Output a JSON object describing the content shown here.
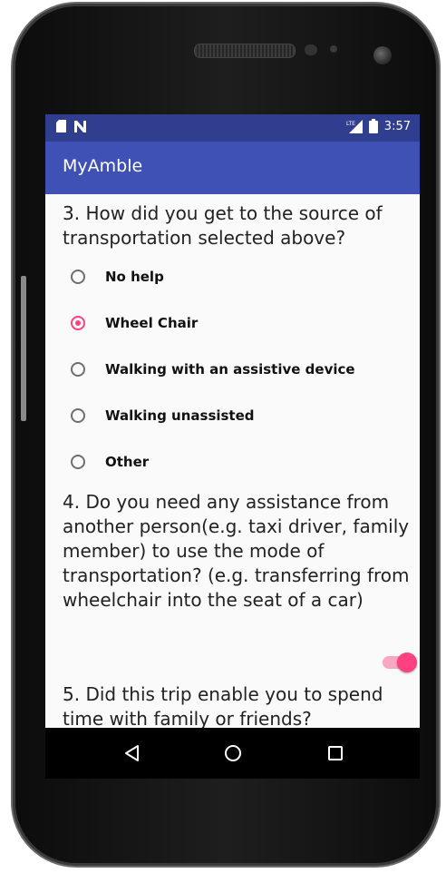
{
  "status_bar": {
    "time": "3:57",
    "left_icons": [
      "sd-card-icon",
      "n-notification-icon"
    ],
    "right_icons": [
      "lte-signal-icon",
      "battery-icon"
    ]
  },
  "app_bar": {
    "title": "MyAmble",
    "color": "#3f51b5",
    "status_color": "#2f3e8f"
  },
  "form": {
    "q3": {
      "text": "3. How did you get to the source of transportation selected above?",
      "options": [
        {
          "label": "No help",
          "checked": false
        },
        {
          "label": "Wheel Chair",
          "checked": true
        },
        {
          "label": "Walking with an assistive device",
          "checked": false
        },
        {
          "label": "Walking unassisted",
          "checked": false
        },
        {
          "label": "Other",
          "checked": false
        }
      ]
    },
    "q4": {
      "text": "4. Do you need any assistance from another person(e.g. taxi driver, family member) to use the mode of transportation? (e.g. transferring from wheelchair into the seat of a car)",
      "toggle_on": true
    },
    "q5": {
      "text": "5. Did this trip enable you to spend time with family or friends?"
    }
  },
  "nav_bar": {
    "buttons": [
      "back-icon",
      "home-icon",
      "recents-icon"
    ]
  },
  "accent_color": "#ff4081"
}
